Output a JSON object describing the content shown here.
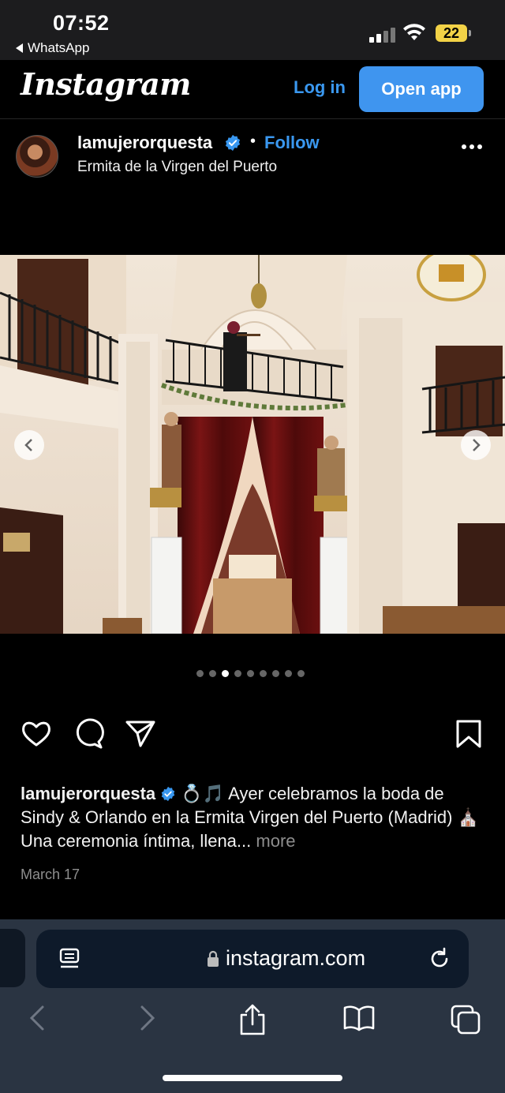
{
  "status_bar": {
    "time": "07:52",
    "back_app": "WhatsApp",
    "battery": "22"
  },
  "ig_header": {
    "logo": "Instagram",
    "login": "Log in",
    "open_app": "Open app"
  },
  "post": {
    "username": "lamujerorquesta",
    "follow": "Follow",
    "location": "Ermita de la Virgen del Puerto",
    "carousel": {
      "count": 9,
      "active_index": 2
    },
    "caption_user": "lamujerorquesta",
    "caption_text": "💍🎵 Ayer celebramos la boda de Sindy & Orlando en la Ermita Virgen del Puerto (Madrid) ⛪ Una ceremonia íntima, llena...",
    "caption_more": "more",
    "date": "March 17"
  },
  "browser": {
    "url": "instagram.com"
  },
  "colors": {
    "accent": "#3f95ef",
    "link": "#3a98f0",
    "battery": "#f2d247"
  }
}
